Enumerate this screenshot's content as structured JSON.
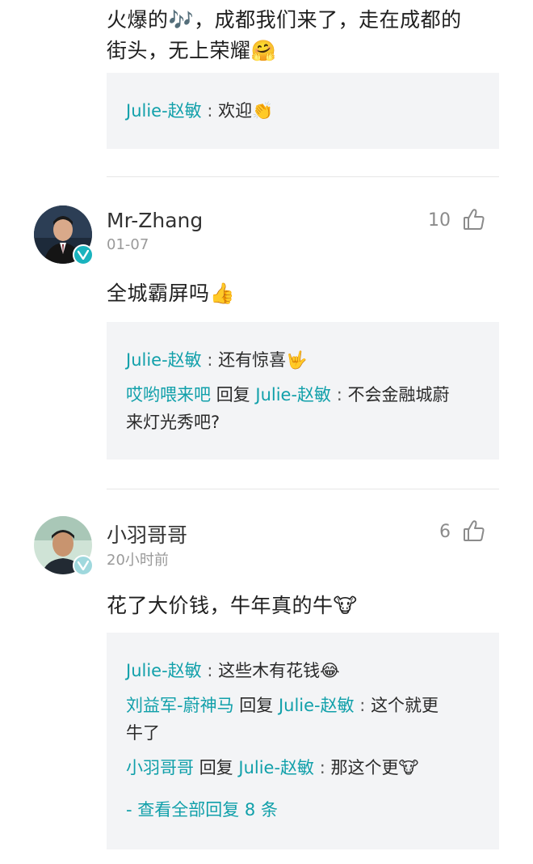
{
  "top_comment": {
    "line1": "火爆的🎶，成都我们来了，走在成都的",
    "line2": "街头，无上荣耀🤗",
    "replies": [
      {
        "author": "Julie-赵敏",
        "text": "欢迎👏"
      }
    ]
  },
  "comments": [
    {
      "username": "Mr-Zhang",
      "time": "01-07",
      "likes": "10",
      "text": "全城霸屏吗👍",
      "replies": [
        {
          "author": "Julie-赵敏",
          "text": "还有惊喜🤟"
        },
        {
          "author": "哎哟喂来吧",
          "reply_word": "回复",
          "target": "Julie-赵敏",
          "text_line1": "不会金融城蔚",
          "text_line2": "来灯光秀吧?"
        }
      ]
    },
    {
      "username": "小羽哥哥",
      "time": "20小时前",
      "likes": "6",
      "text": "花了大价钱，牛年真的牛🐮",
      "replies": [
        {
          "author": "Julie-赵敏",
          "text": "这些木有花钱😂"
        },
        {
          "author": "刘益军-蔚神马",
          "reply_word": "回复",
          "target": "Julie-赵敏",
          "text_line1": "这个就更",
          "text_line2": "牛了"
        },
        {
          "author": "小羽哥哥",
          "reply_word": "回复",
          "target": "Julie-赵敏",
          "text": "那这个更🐮"
        }
      ],
      "view_all": "- 查看全部回复 8 条"
    }
  ],
  "separator": " : ",
  "colors": {
    "accent": "#11a0aa",
    "badge": "#19b3be",
    "reply_bg": "#f3f4f6"
  },
  "icons": {
    "like": "thumbs-up-outline-icon",
    "verified": "verified-v-badge-icon"
  }
}
